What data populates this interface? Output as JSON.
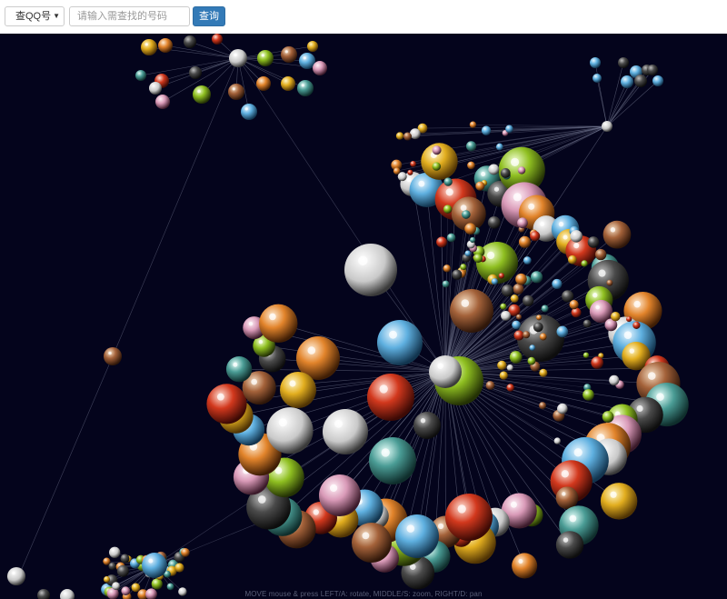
{
  "search": {
    "select_value": "查QQ号",
    "placeholder": "请输入需查找的号码",
    "button_label": "查询"
  },
  "graph": {
    "background": "#04041c",
    "link_color": "#8a8fa8"
  },
  "hint": "MOVE mouse & press LEFT/A: rotate, MIDDLE/S: zoom, RIGHT/D: pan"
}
